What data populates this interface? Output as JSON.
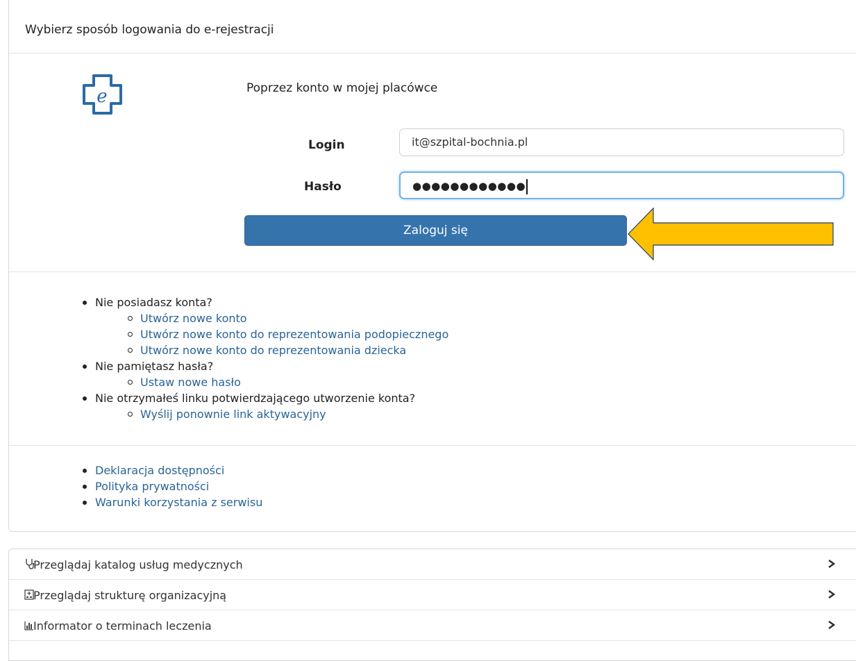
{
  "panel": {
    "title": "Wybierz sposób logowania do e-rejestracji",
    "logo_icon": "e-cross-logo-icon",
    "method_title": "Poprzez konto w mojej placówce",
    "login_label": "Login",
    "login_value": "it@szpital-bochnia.pl",
    "password_label": "Hasło",
    "password_mask": "●●●●●●●●●●●●",
    "login_button": "Zaloguj się",
    "annotation_arrow_color": "#ffc000"
  },
  "help": {
    "no_account": "Nie posiadasz konta?",
    "create_account": "Utwórz nowe konto",
    "create_ward_account": "Utwórz nowe konto do reprezentowania podopiecznego",
    "create_child_account": "Utwórz nowe konto do reprezentowania dziecka",
    "forgot_password": "Nie pamiętasz hasła?",
    "set_new_password": "Ustaw nowe hasło",
    "no_activation_link": "Nie otrzymałeś linku potwierdzającego utworzenie konta?",
    "resend_link": "Wyślij ponownie link aktywacyjny"
  },
  "legal": {
    "accessibility": "Deklaracja dostępności",
    "privacy": "Polityka prywatności",
    "terms": "Warunki korzystania z serwisu"
  },
  "nav": {
    "catalog": "Przeglądaj katalog usług medycznych",
    "structure": "Przeglądaj strukturę organizacyjną",
    "informator": "Informator o terminach leczenia"
  },
  "colors": {
    "primary_button": "#3573ad",
    "link": "#2a6496",
    "logo": "#2b6aa8"
  }
}
